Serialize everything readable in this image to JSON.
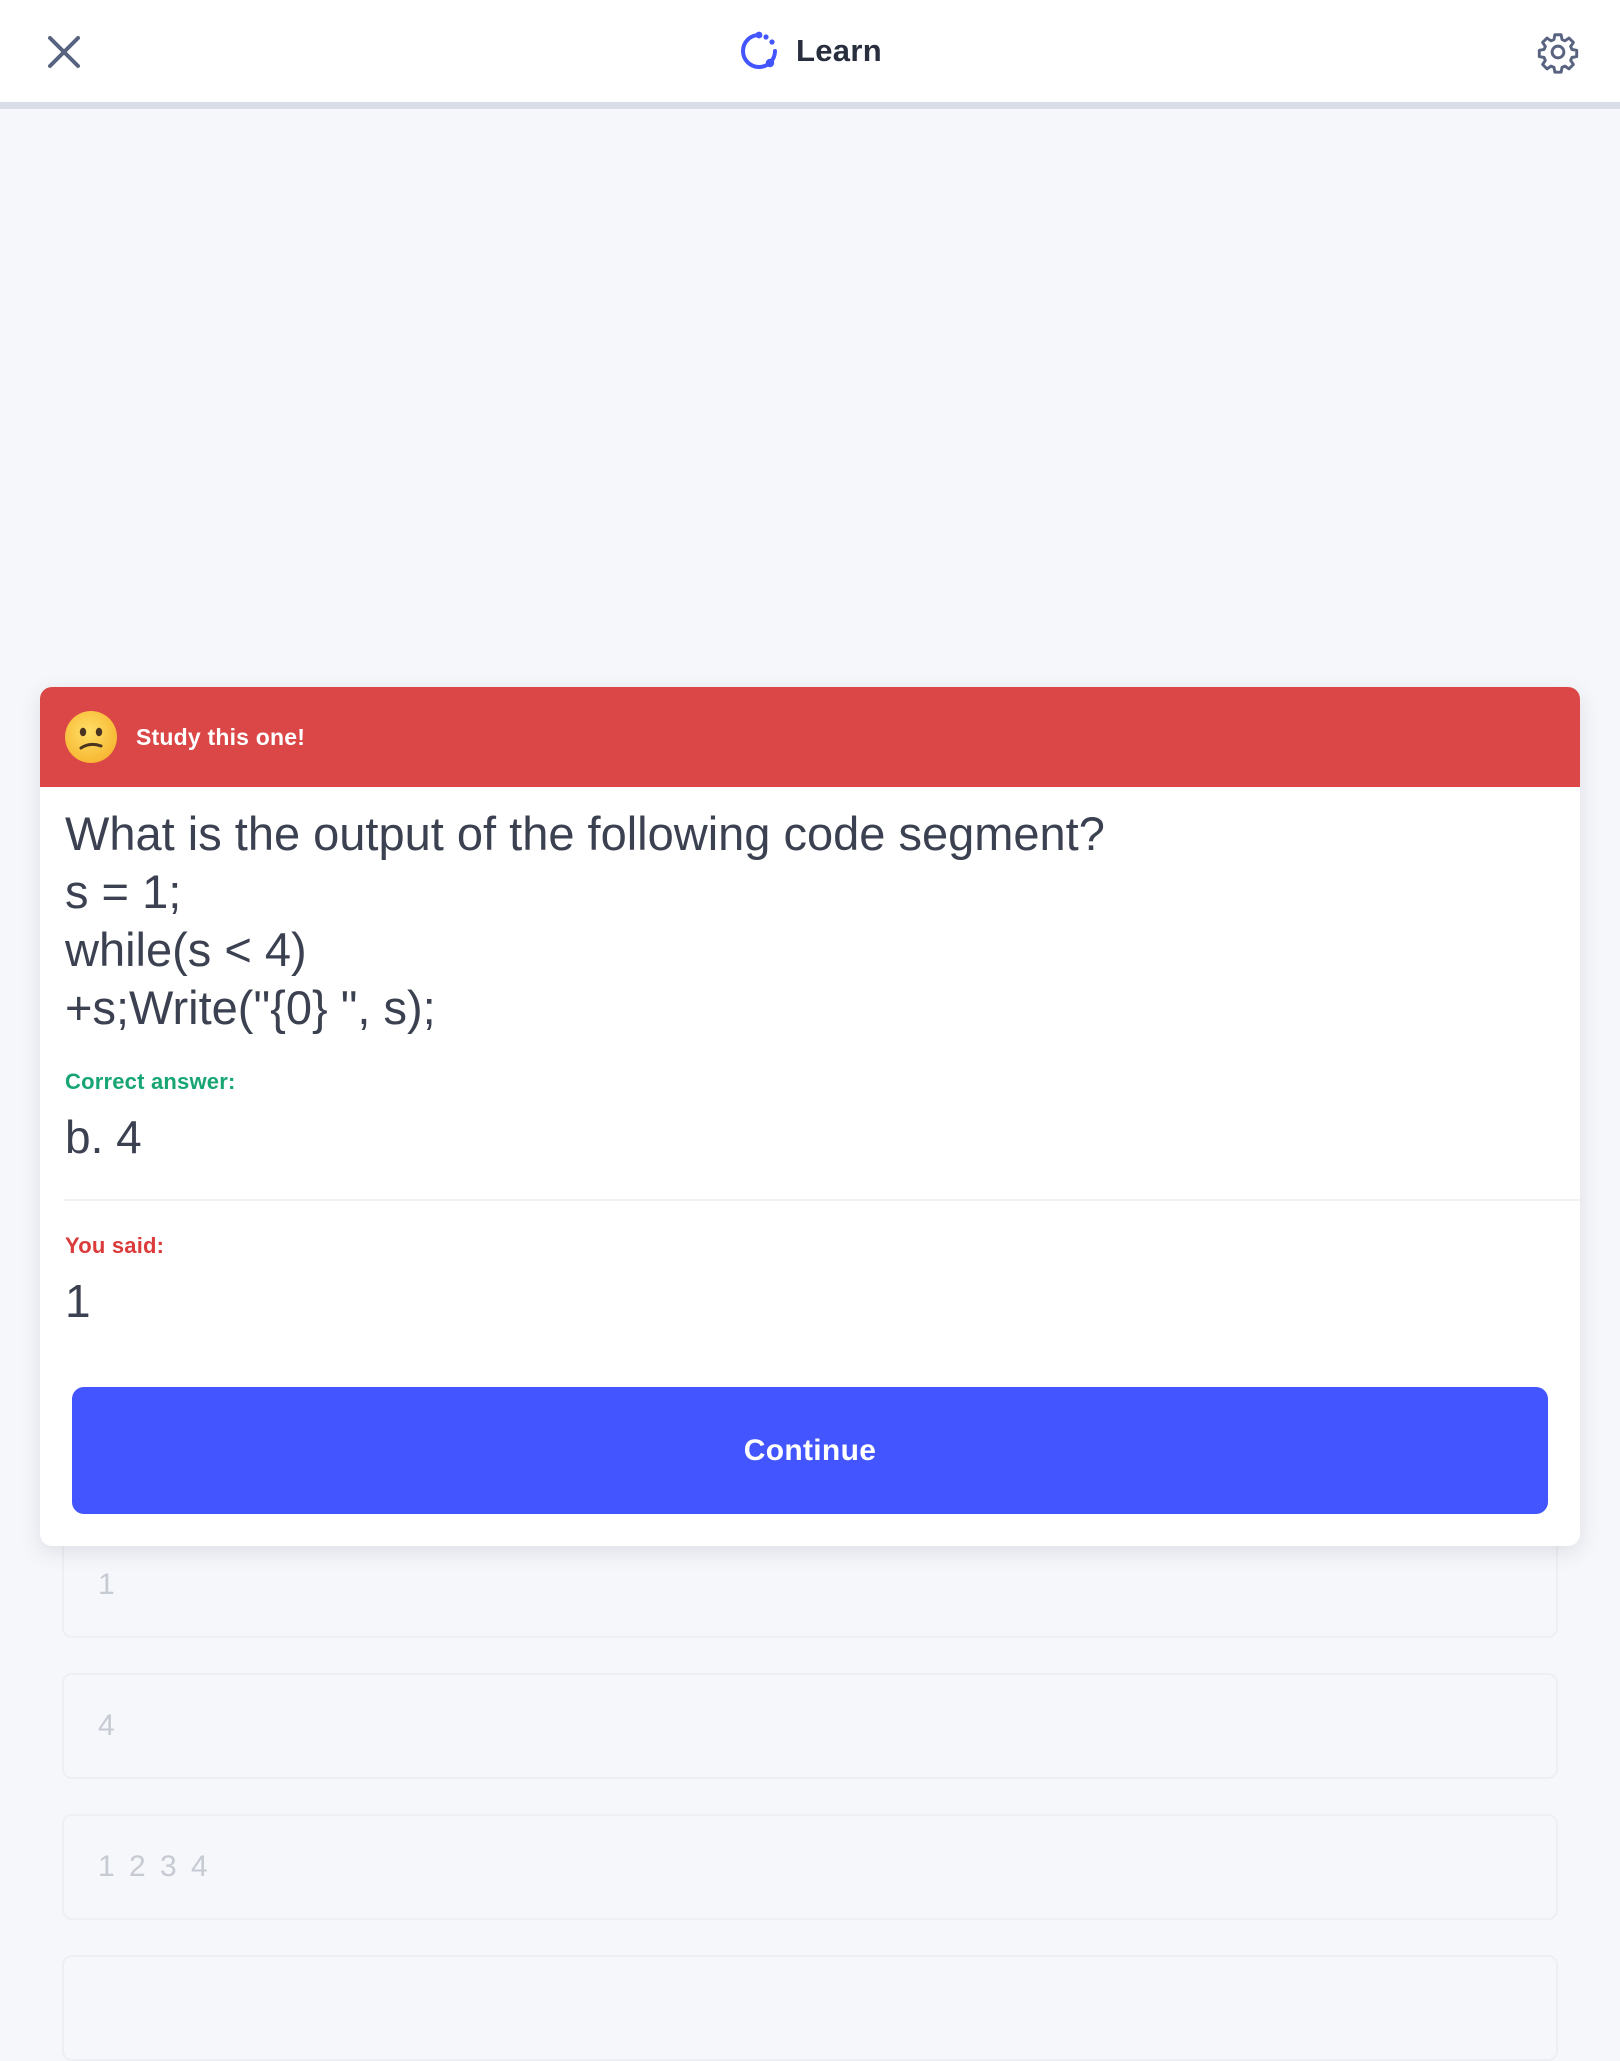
{
  "header": {
    "title": "Learn",
    "close_icon": "close-icon",
    "brand_icon": "learn-mode-icon",
    "settings_icon": "gear-icon",
    "brand_color": "#4255ff"
  },
  "background_options": [
    {
      "text": "1"
    },
    {
      "text": "4"
    },
    {
      "text": "1 2 3 4"
    }
  ],
  "feedback": {
    "banner_text": "Study this one!",
    "banner_icon": "confused-face-emoji",
    "banner_color": "#db4646",
    "question_lines": [
      "What is the output of the following code segment?",
      "s = 1;",
      "while(s < 4)",
      "+s;Write(\"{0} \", s);"
    ],
    "correct_label": "Correct answer:",
    "correct_answer": "b. 4",
    "said_label": "You said:",
    "said_answer": "1",
    "continue_label": "Continue"
  }
}
